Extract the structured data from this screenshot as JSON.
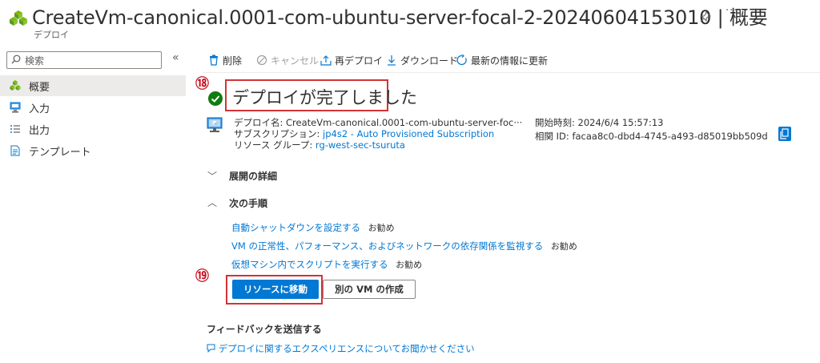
{
  "header": {
    "title": "CreateVm-canonical.0001-com-ubuntu-server-focal-2-20240604153010 | 概要",
    "subtitle": "デプロイ",
    "more": "···"
  },
  "sidebar": {
    "search_placeholder": "検索",
    "collapse": "«",
    "items": [
      {
        "label": "概要",
        "active": true
      },
      {
        "label": "入力"
      },
      {
        "label": "出力"
      },
      {
        "label": "テンプレート"
      }
    ]
  },
  "toolbar": {
    "delete": "削除",
    "cancel": "キャンセル",
    "redeploy": "再デプロイ",
    "download": "ダウンロード",
    "refresh": "最新の情報に更新"
  },
  "markers": {
    "m18": "⑱",
    "m19": "⑲"
  },
  "deployment": {
    "status_title": "デプロイが完了しました",
    "name_label": "デプロイ名:",
    "name_value": "CreateVm-canonical.0001-com-ubuntu-server-foc···",
    "subscription_label": "サブスクリプション:",
    "subscription_value": "jp4s2 - Auto Provisioned Subscription",
    "rg_label": "リソース グループ:",
    "rg_value": "rg-west-sec-tsuruta",
    "start_label": "開始時刻:",
    "start_value": "2024/6/4 15:57:13",
    "correlation_label": "相関 ID:",
    "correlation_value": "facaa8c0-dbd4-4745-a493-d85019bb509d"
  },
  "sections": {
    "details": "展開の詳細",
    "next_steps": "次の手順"
  },
  "next_steps": [
    {
      "link": "自動シャットダウンを設定する",
      "tag": "お勧め"
    },
    {
      "link": "VM の正常性、パフォーマンス、およびネットワークの依存関係を監視する",
      "tag": "お勧め"
    },
    {
      "link": "仮想マシン内でスクリプトを実行する",
      "tag": "お勧め"
    }
  ],
  "buttons": {
    "go_to_resource": "リソースに移動",
    "create_another": "別の VM の作成"
  },
  "feedback": {
    "title": "フィードバックを送信する",
    "link": "デプロイに関するエクスペリエンスについてお聞かせください"
  },
  "colors": {
    "accent": "#0078d4",
    "success": "#107c10",
    "highlight": "#d13438"
  }
}
